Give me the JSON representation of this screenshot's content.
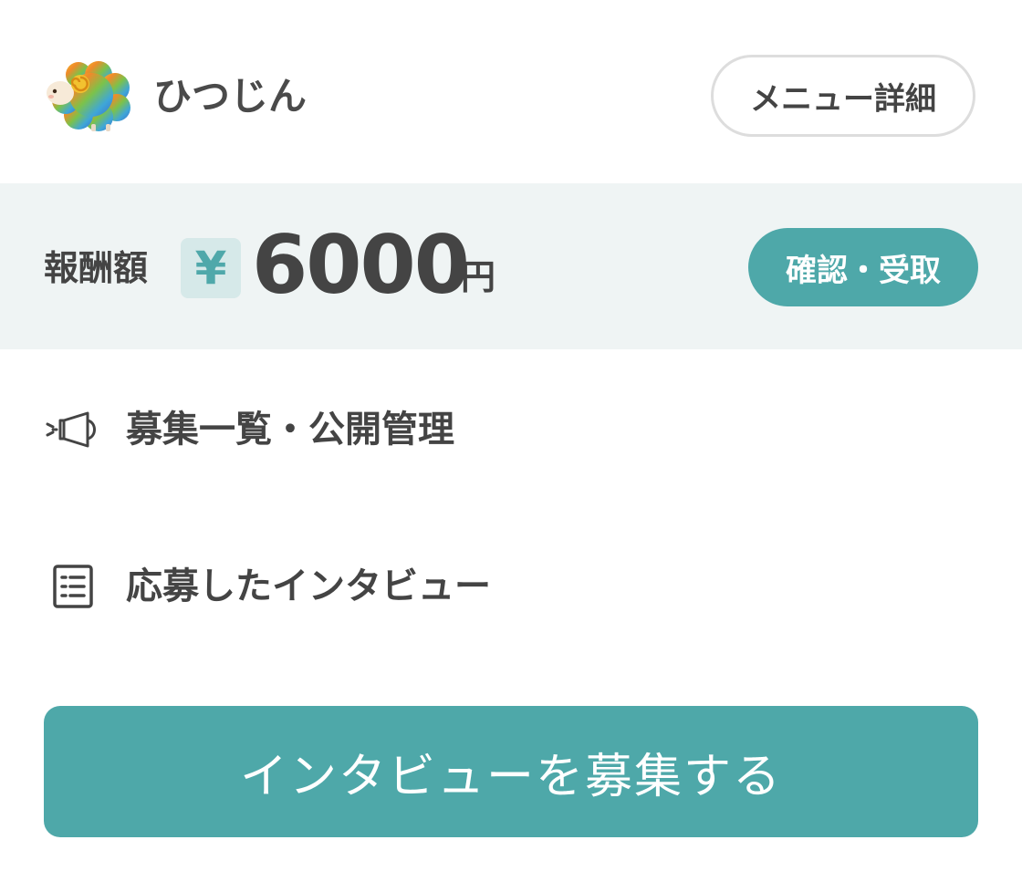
{
  "header": {
    "username": "ひつじん",
    "menu_detail_label": "メニュー詳細"
  },
  "reward": {
    "label": "報酬額",
    "currency_icon": "¥",
    "amount": "6000",
    "unit": "円",
    "confirm_label": "確認・受取"
  },
  "menu": {
    "items": [
      {
        "label": "募集一覧・公開管理",
        "icon": "megaphone-icon"
      },
      {
        "label": "応募したインタビュー",
        "icon": "list-icon"
      }
    ]
  },
  "cta": {
    "label": "インタビューを募集する"
  },
  "colors": {
    "accent": "#4ea8a9",
    "band_background": "#eff4f4",
    "text": "#444444"
  }
}
